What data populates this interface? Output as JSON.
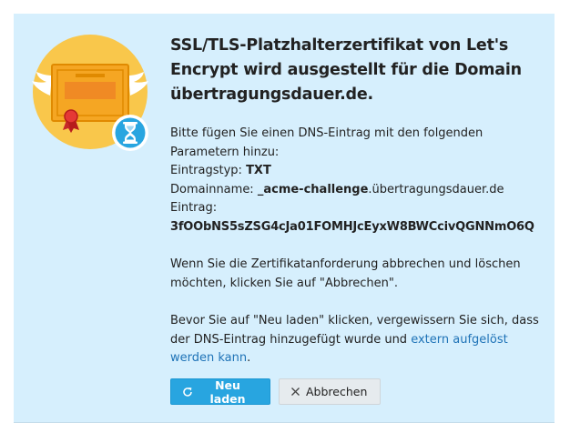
{
  "dialog": {
    "title": "SSL/TLS-Platzhalterzertifikat von Let's Encrypt wird ausgestellt für die Domain übertragungsdauer.de.",
    "instructions": {
      "line1": "Bitte fügen Sie einen DNS-Eintrag mit den folgenden Parametern hinzu:",
      "record_type_label": "Eintragstyp:",
      "record_type_value": "TXT",
      "domain_name_label": "Domainname:",
      "domain_name_prefix": "_acme-challenge",
      "domain_name_suffix": ".übertragungsdauer.de",
      "record_label": "Eintrag:",
      "record_value": "3fOObNS5sZSG4cJa01FOMHJcEyxW8BWCcivQGNNmO6Q"
    },
    "cancel_note": "Wenn Sie die Zertifikatanforderung abbrechen und löschen möchten, klicken Sie auf \"Abbrechen\".",
    "reload_note_before_link": "Bevor Sie auf \"Neu laden\" klicken, vergewissern Sie sich, dass der DNS-Eintrag hinzugefügt wurde und ",
    "reload_note_link": "extern aufgelöst werden kann",
    "reload_note_after_link": "."
  },
  "buttons": {
    "reload_label": "Neu laden",
    "cancel_label": "Abbrechen"
  },
  "icons": {
    "illustration": "certificate-icon",
    "reload": "refresh-icon",
    "cancel": "close-icon",
    "pending": "hourglass-icon"
  },
  "colors": {
    "panel_background": "#d6effd",
    "primary_button": "#28a5e0",
    "link": "#1f73b7",
    "illustration_circle": "#f9c74b"
  }
}
